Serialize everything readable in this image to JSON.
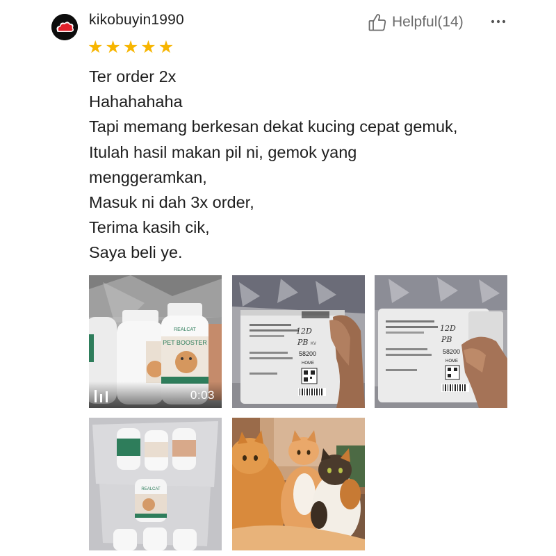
{
  "review": {
    "username": "kikobuyin1990",
    "rating": 5,
    "rating_max": 5,
    "avatar_icon": "red-cloud-logo-icon",
    "helpful_label": "Helpful",
    "helpful_count": "(14)",
    "more_icon": "more-dots-icon",
    "lines": [
      "Ter order 2x",
      "Hahahahaha",
      "Tapi memang berkesan dekat kucing cepat gemuk,",
      "Itulah hasil makan pil ni, gemok yang",
      "menggeramkan,",
      "Masuk ni dah 3x order,",
      "Terima kasih cik,",
      "Saya beli ye."
    ]
  },
  "media": [
    {
      "type": "video",
      "duration": "0:03",
      "icon": "video-icon",
      "photo_text": [
        "REALCAT",
        "PET BOOSTER"
      ]
    },
    {
      "type": "photo",
      "photo_text": [
        "58200",
        "HOME",
        "12D",
        "PB",
        "KV"
      ]
    },
    {
      "type": "photo",
      "photo_text": [
        "58200",
        "HOME",
        "12D",
        "PB"
      ]
    },
    {
      "type": "photo",
      "photo_text": [
        "REALCAT"
      ]
    },
    {
      "type": "photo",
      "photo_text": []
    }
  ],
  "colors": {
    "star": "#f7b500",
    "text": "#1e1e1e",
    "muted": "#6b6b6b",
    "logo_red": "#e0202a"
  }
}
